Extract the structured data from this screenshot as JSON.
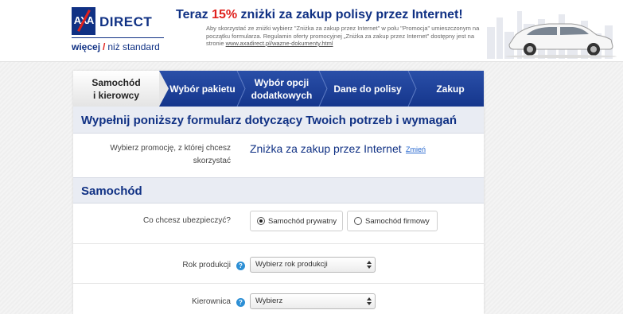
{
  "header": {
    "logo": {
      "brand": "AXA",
      "name": "DIRECT",
      "tagline_bold": "więcej",
      "tagline_rest": "niż standard"
    },
    "promo": {
      "title_before": "Teraz",
      "title_percent": "15%",
      "title_after": "zniżki za zakup polisy przez Internet!",
      "text": "Aby skorzystać ze zniżki wybierz \"Zniżka za zakup przez Internet\" w polu \"Promocja\" umieszczonym na początku formularza. Regulamin oferty promocyjnej „Zniżka za zakup przez Internet\" dostępny jest na stronie",
      "link": "www.axadirect.pl/wazne-dokumenty.html"
    }
  },
  "steps": [
    {
      "label_line1": "Samochód",
      "label_line2": "i kierowcy",
      "active": true
    },
    {
      "label_line1": "Wybór pakietu",
      "label_line2": "",
      "active": false
    },
    {
      "label_line1": "Wybór opcji",
      "label_line2": "dodatkowych",
      "active": false
    },
    {
      "label_line1": "Dane do polisy",
      "label_line2": "",
      "active": false
    },
    {
      "label_line1": "Zakup",
      "label_line2": "",
      "active": false
    }
  ],
  "form": {
    "title": "Wypełnij poniższy formularz dotyczący Twoich potrzeb i wymagań",
    "promotion": {
      "label_line1": "Wybierz promocję, z której chcesz",
      "label_line2": "skorzystać",
      "value": "Zniżka za zakup przez Internet",
      "change_link": "Zmień"
    },
    "section_car": "Samochód",
    "insure": {
      "label": "Co chcesz ubezpieczyć?",
      "options": [
        "Samochód prywatny",
        "Samochód firmowy"
      ],
      "selected": "Samochód prywatny"
    },
    "year": {
      "label": "Rok produkcji",
      "value": "Wybierz rok produkcji"
    },
    "steering": {
      "label": "Kierownica",
      "value": "Wybierz"
    }
  },
  "colors": {
    "brand_blue": "#103184",
    "accent_red": "#e0211d",
    "link_blue": "#2a6ad0",
    "help_blue": "#2d8fd5"
  }
}
